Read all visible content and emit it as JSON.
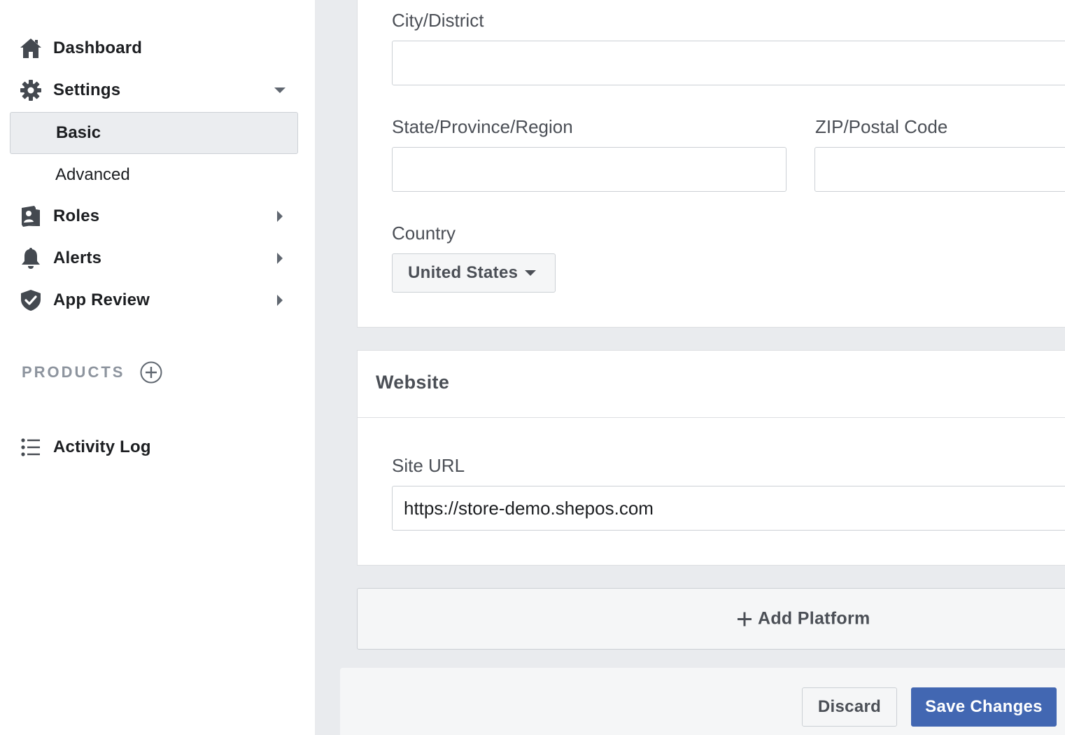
{
  "sidebar": {
    "items": [
      {
        "label": "Dashboard",
        "icon": "home-icon"
      },
      {
        "label": "Settings",
        "icon": "gear-icon",
        "expanded": true
      },
      {
        "label": "Roles",
        "icon": "roles-icon"
      },
      {
        "label": "Alerts",
        "icon": "bell-icon"
      },
      {
        "label": "App Review",
        "icon": "shield-check-icon"
      }
    ],
    "settings_sub": [
      {
        "label": "Basic",
        "active": true
      },
      {
        "label": "Advanced",
        "active": false
      }
    ],
    "products_label": "PRODUCTS",
    "activity_log": "Activity Log"
  },
  "address": {
    "city_label": "City/District",
    "city_value": "",
    "state_label": "State/Province/Region",
    "state_value": "",
    "zip_label": "ZIP/Postal Code",
    "zip_value": "",
    "country_label": "Country",
    "country_value": "United States"
  },
  "website": {
    "title": "Website",
    "site_url_label": "Site URL",
    "site_url_value": "https://store-demo.shepos.com"
  },
  "add_platform_label": "Add Platform",
  "footer": {
    "discard_label": "Discard",
    "save_label": "Save Changes"
  },
  "colors": {
    "primary": "#4267b2",
    "sidebar_active_bg": "#ebedf0",
    "page_bg": "#e9ebee",
    "icon": "#444950"
  }
}
